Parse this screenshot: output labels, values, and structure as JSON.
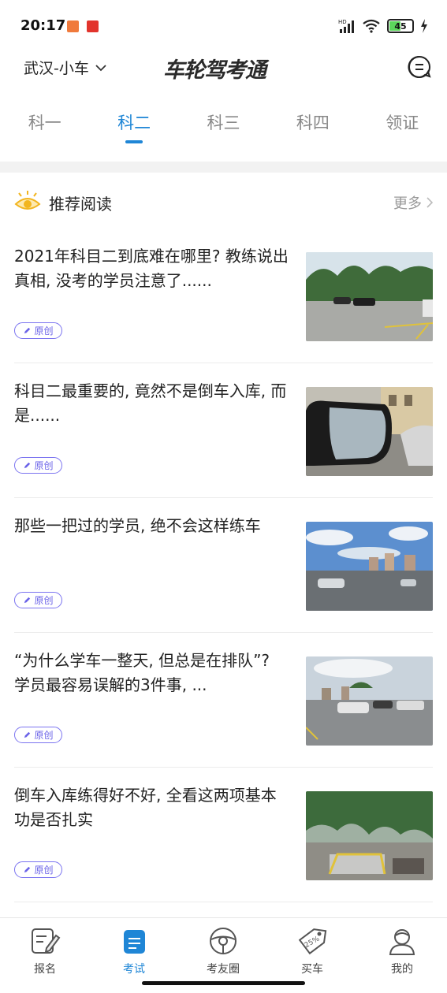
{
  "status_bar": {
    "time": "20:17",
    "battery_level": "45",
    "battery_fraction": 0.45,
    "network_label": "HD",
    "icons": [
      "signal-icon",
      "wifi-icon",
      "battery-icon",
      "charging-icon"
    ]
  },
  "header": {
    "city": "武汉-小车",
    "brand": "车轮驾考通"
  },
  "tabs": [
    {
      "label": "科一",
      "active": false
    },
    {
      "label": "科二",
      "active": true
    },
    {
      "label": "科三",
      "active": false
    },
    {
      "label": "科四",
      "active": false
    },
    {
      "label": "领证",
      "active": false
    }
  ],
  "section": {
    "title": "推荐阅读",
    "more": "更多"
  },
  "articles": [
    {
      "title": "2021年科目二到底难在哪里? 教练说出真相, 没考的学员注意了......",
      "tag": "原创"
    },
    {
      "title": "科目二最重要的, 竟然不是倒车入库, 而是......",
      "tag": "原创"
    },
    {
      "title": "那些一把过的学员, 绝不会这样练车",
      "tag": "原创"
    },
    {
      "title": "“为什么学车一整天, 但总是在排队”? 学员最容易误解的3件事, ...",
      "tag": "原创"
    },
    {
      "title": "倒车入库练得好不好, 全看这两项基本功是否扎实",
      "tag": "原创"
    }
  ],
  "tabbar": [
    {
      "label": "报名",
      "icon": "signup-icon",
      "active": false
    },
    {
      "label": "考试",
      "icon": "exam-icon",
      "active": true
    },
    {
      "label": "考友圈",
      "icon": "steering-wheel-icon",
      "active": false
    },
    {
      "label": "买车",
      "icon": "price-tag-icon",
      "active": false
    },
    {
      "label": "我的",
      "icon": "profile-icon",
      "active": false
    }
  ],
  "colors": {
    "accent": "#1f86d6",
    "tag": "#6a62e8",
    "eye": "#f2b51f",
    "inactive_tab": "#888888"
  }
}
